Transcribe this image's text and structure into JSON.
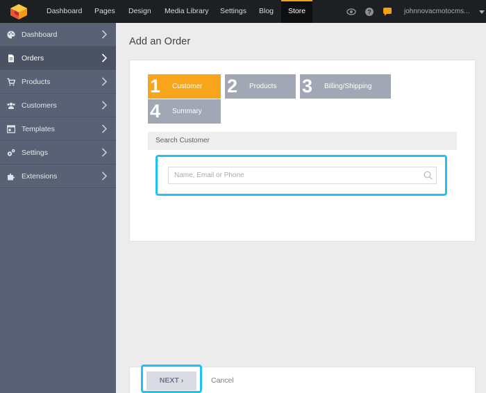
{
  "topbar": {
    "nav": [
      "Dashboard",
      "Pages",
      "Design",
      "Media Library",
      "Settings",
      "Blog",
      "Store"
    ],
    "active": "Store",
    "accent_color": "#f5a20a",
    "icons": [
      "eye-icon",
      "help-icon",
      "chat-icon"
    ],
    "user": "johnnovacmotocms..."
  },
  "sidebar": {
    "items": [
      {
        "label": "Dashboard",
        "icon": "palette-icon"
      },
      {
        "label": "Orders",
        "icon": "document-icon"
      },
      {
        "label": "Products",
        "icon": "cart-icon"
      },
      {
        "label": "Customers",
        "icon": "users-icon"
      },
      {
        "label": "Templates",
        "icon": "template-icon"
      },
      {
        "label": "Settings",
        "icon": "gears-icon"
      },
      {
        "label": "Extensions",
        "icon": "puzzle-icon"
      }
    ],
    "active": "Orders"
  },
  "main": {
    "title": "Add an Order",
    "steps": [
      {
        "num": "1",
        "label": "Customer"
      },
      {
        "num": "2",
        "label": "Products"
      },
      {
        "num": "3",
        "label": "Billing/Shipping"
      },
      {
        "num": "4",
        "label": "Summary"
      }
    ],
    "active_step": 1,
    "step_active_color": "#f8a51b",
    "step_inactive_color": "#a2a7b5",
    "search_header": "Search Customer",
    "search_placeholder": "Name, Email or Phone",
    "highlight_color": "#1ec3f0"
  },
  "footer": {
    "next_label": "NEXT",
    "next_chevron": "›",
    "cancel_label": "Cancel"
  }
}
